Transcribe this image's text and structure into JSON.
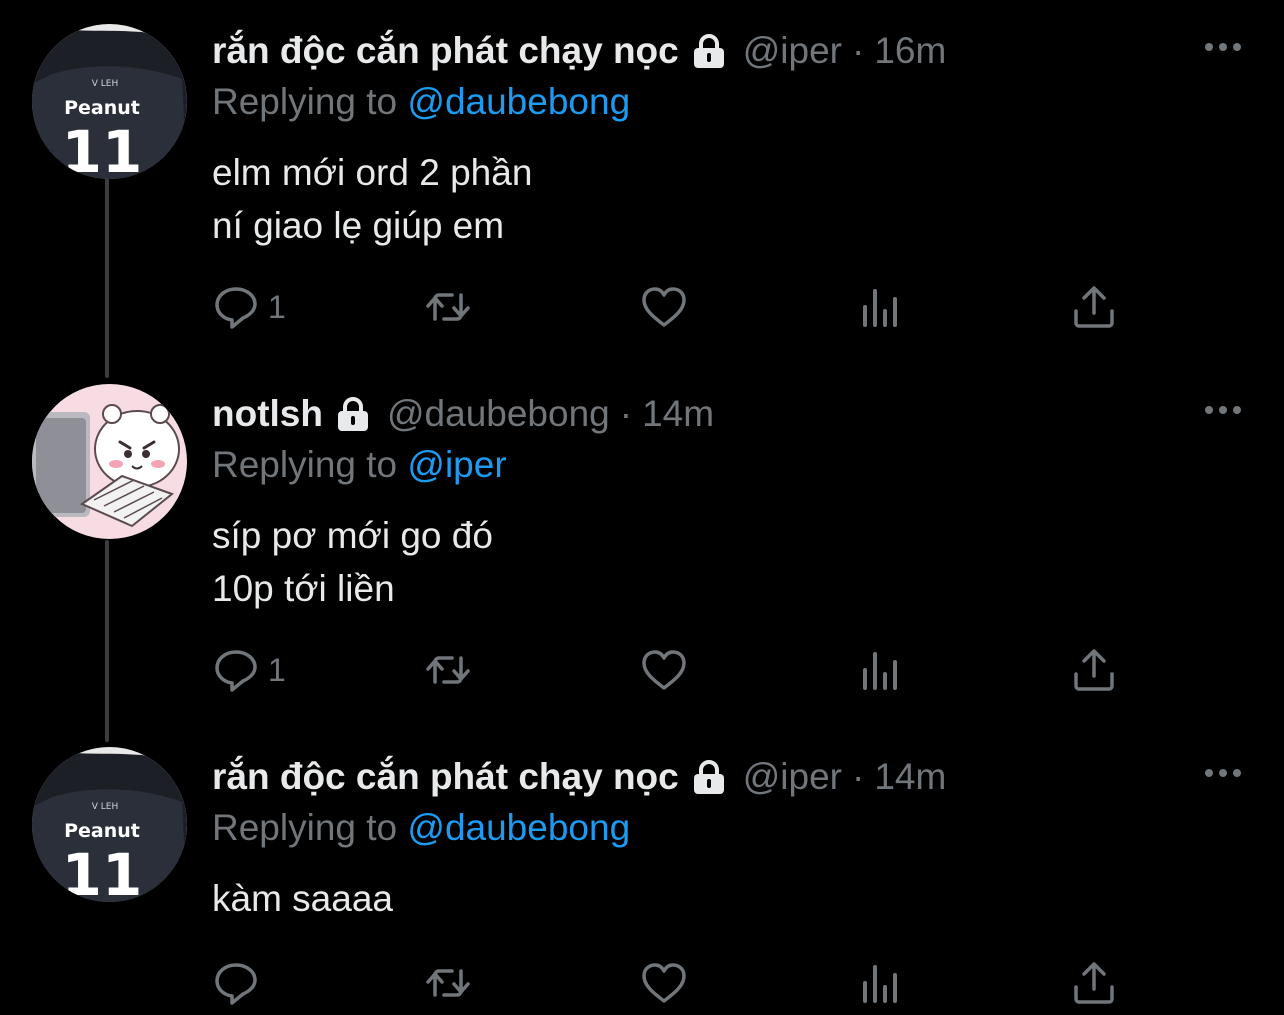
{
  "tweets": [
    {
      "display_name": "rắn độc cắn phát chạy nọc",
      "handle": "@iper",
      "separator": "·",
      "time": "16m",
      "replying_label": "Replying to ",
      "replying_to": "@daubebong",
      "text_lines": [
        "elm mới ord 2 phần",
        "ní giao lẹ giúp em"
      ],
      "reply_count": "1",
      "avatar_icon": "peanut-jersey-avatar",
      "avatar_text": {
        "top": "V LEH",
        "name": "Peanut",
        "number": "11"
      }
    },
    {
      "display_name": "notlsh",
      "handle": "@daubebong",
      "separator": "·",
      "time": "14m",
      "replying_label": "Replying to ",
      "replying_to": "@iper",
      "text_lines": [
        "síp pơ mới go đó",
        "10p tới liền"
      ],
      "reply_count": "1",
      "avatar_icon": "cartoon-bear-keyboard-avatar"
    },
    {
      "display_name": "rắn độc cắn phát chạy nọc",
      "handle": "@iper",
      "separator": "·",
      "time": "14m",
      "replying_label": "Replying to ",
      "replying_to": "@daubebong",
      "text_lines": [
        "kàm saaaa"
      ],
      "reply_count": "",
      "avatar_icon": "peanut-jersey-avatar",
      "avatar_text": {
        "top": "V LEH",
        "name": "Peanut",
        "number": "11"
      }
    }
  ],
  "colors": {
    "background": "#000000",
    "text": "#e7e9ea",
    "muted": "#71767b",
    "accent": "#1d9bf0",
    "thread_line": "#3a3d40"
  },
  "icons": [
    "lock-icon",
    "more-icon",
    "reply-icon",
    "retweet-icon",
    "like-icon",
    "views-icon",
    "share-icon"
  ]
}
